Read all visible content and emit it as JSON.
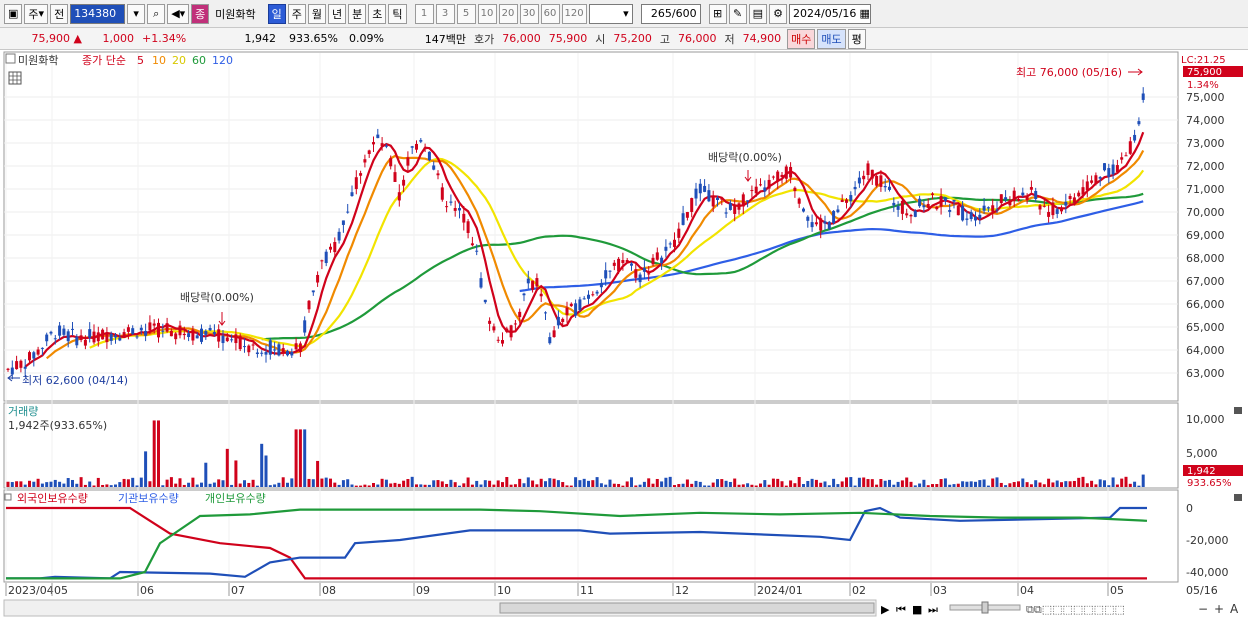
{
  "toolbar": {
    "market": "주",
    "prev": "전",
    "stock_code": "134380",
    "stock_name": "미원화학",
    "periods": [
      "일",
      "주",
      "월",
      "년",
      "분",
      "초",
      "틱"
    ],
    "active_period": "일",
    "tick_options": [
      "1",
      "3",
      "5",
      "10",
      "20",
      "30",
      "60",
      "120"
    ],
    "count_current": "265",
    "count_total": "/600",
    "date": "2024/05/16"
  },
  "quote": {
    "price": "75,900",
    "change": "1,000",
    "change_pct": "+1.34%",
    "volume": "1,942",
    "volume_ratio": "933.65%",
    "turnover_rate": "0.09%",
    "trade_value": "147백만",
    "ask_label": "호가",
    "ask": "76,000",
    "bid": "75,900",
    "open_label": "시",
    "open": "75,200",
    "high_label": "고",
    "high": "76,000",
    "low_label": "저",
    "low": "74,900",
    "buy_label": "매수",
    "sell_label": "매도",
    "eval_label": "평"
  },
  "price_chart": {
    "legend_name": "미원화학",
    "legend_ma_label": "종가 단순",
    "ma_periods": [
      "5",
      "10",
      "20",
      "60",
      "120"
    ],
    "lc_label": "LC:21.25",
    "last_price_tag": "75,900",
    "last_pct_tag": "1.34%",
    "high_annotation": "최고 76,000 (05/16)",
    "low_annotation": "최저 62,600 (04/14)",
    "dividend_label_1": "배당락(0.00%)",
    "dividend_label_2": "배당락(0.00%)",
    "y_ticks": [
      "75,000",
      "74,000",
      "73,000",
      "72,000",
      "71,000",
      "70,000",
      "69,000",
      "68,000",
      "67,000",
      "66,000",
      "65,000",
      "64,000",
      "63,000"
    ]
  },
  "volume_chart": {
    "title": "거래량",
    "current": "1,942주(933.65%)",
    "y_ticks": [
      "10,000",
      "5,000"
    ],
    "tag_value": "1,942",
    "tag_pct": "933.65%"
  },
  "holdings_chart": {
    "legend": [
      "외국인보유수량",
      "기관보유수량",
      "개인보유수량"
    ],
    "y_ticks": [
      "0",
      "-20,000",
      "-40,000"
    ]
  },
  "x_axis": {
    "labels": [
      "2023/04",
      "05",
      "06",
      "07",
      "08",
      "09",
      "10",
      "11",
      "12",
      "2024/01",
      "02",
      "03",
      "04",
      "05"
    ],
    "right_label": "05/16"
  },
  "colors": {
    "up": "#d0021b",
    "down": "#1f4fb8",
    "ma5": "#d0021b",
    "ma10": "#f08a00",
    "ma20": "#f2e400",
    "ma60": "#1f9a3a",
    "ma120": "#2e5ee6"
  }
}
